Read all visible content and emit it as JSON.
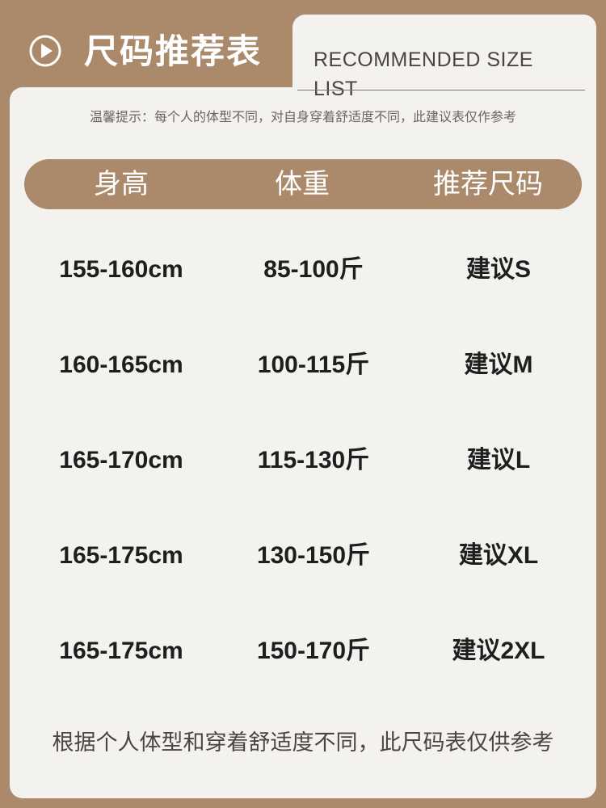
{
  "header": {
    "title": "尺码推荐表",
    "subtitle": "RECOMMENDED SIZE LIST",
    "icon": "play-circle-icon"
  },
  "tip": "温馨提示：每个人的体型不同，对自身穿着舒适度不同，此建议表仅作参考",
  "table": {
    "columns": [
      "身高",
      "体重",
      "推荐尺码"
    ],
    "rows": [
      [
        "155-160cm",
        "85-100斤",
        "建议S"
      ],
      [
        "160-165cm",
        "100-115斤",
        "建议M"
      ],
      [
        "165-170cm",
        "115-130斤",
        "建议L"
      ],
      [
        "165-175cm",
        "130-150斤",
        "建议XL"
      ],
      [
        "165-175cm",
        "150-170斤",
        "建议2XL"
      ]
    ]
  },
  "footer": "根据个人体型和穿着舒适度不同，此尺码表仅供参考",
  "colors": {
    "accent": "#ab8a6c",
    "card": "#f3f2ef",
    "text": "#1e1e1e"
  }
}
